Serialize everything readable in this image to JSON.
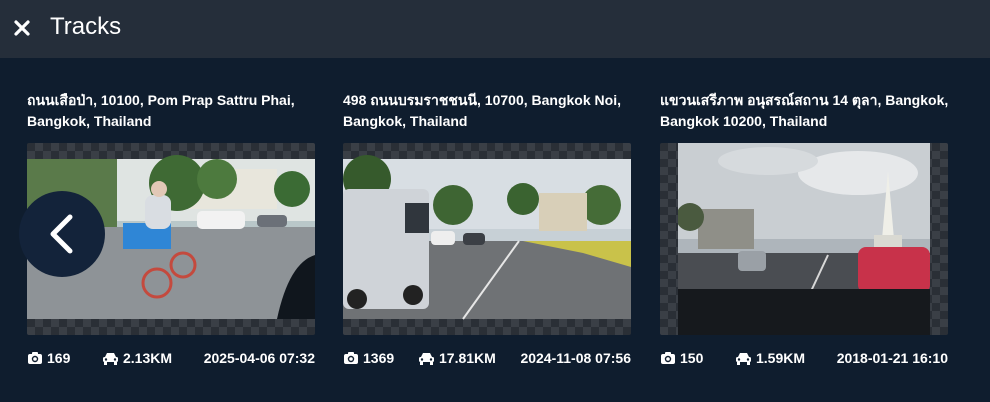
{
  "header": {
    "title": "Tracks",
    "close_icon": "close-icon"
  },
  "tracks": [
    {
      "address_line1": "ถนนเสือป่า, 10100, Pom Prap Sattru Phai,",
      "address_line2": "Bangkok, Thailand",
      "photos": "169",
      "distance": "2.13KM",
      "date": "2025-04-06 07:32"
    },
    {
      "address_line1": "498 ถนนบรมราชชนนี, 10700, Bangkok Noi,",
      "address_line2": "Bangkok, Thailand",
      "photos": "1369",
      "distance": "17.81KM",
      "date": "2024-11-08 07:56"
    },
    {
      "address_line1": "แขวนเสรีภาพ อนุสรณ์สถาน 14 ตุลา, Bangkok,",
      "address_line2": "Bangkok 10200, Thailand",
      "photos": "150",
      "distance": "1.59KM",
      "date": "2018-01-21 16:10"
    }
  ],
  "icons": {
    "photos": "camera-icon",
    "distance": "car-icon",
    "prev": "chevron-left-icon"
  },
  "colors": {
    "background": "#0f1d2e",
    "header": "#252e3a",
    "text": "#ffffff"
  }
}
